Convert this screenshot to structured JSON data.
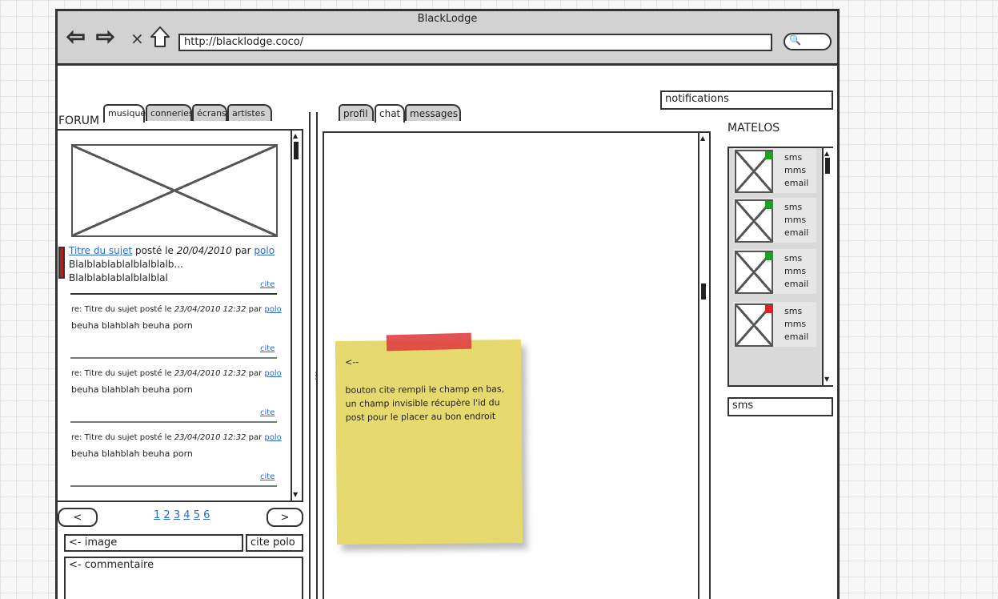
{
  "browser": {
    "title": "BlackLodge",
    "url": "http://blacklodge.coco/"
  },
  "header": {
    "notifications_label": "notifications"
  },
  "forum": {
    "label": "FORUM",
    "tabs": [
      "musique",
      "conneries",
      "écrans",
      "artistes"
    ],
    "active_tab": "musique",
    "topic": {
      "title": "Titre du sujet",
      "posted_on": "posté le",
      "date": "20/04/2010",
      "by": "par",
      "author": "polo",
      "excerpt_line1": "Blalblablablalblalblalb...",
      "excerpt_line2": "Blalblablablalblalblal",
      "cite": "cite"
    },
    "replies": [
      {
        "prefix": "re: Titre du sujet posté le",
        "date": "23/04/2010 12:32",
        "by": "par",
        "author": "polo",
        "body": "beuha blahblah beuha porn",
        "cite": "cite"
      },
      {
        "prefix": "re: Titre du sujet posté le",
        "date": "23/04/2010 12:32",
        "by": "par",
        "author": "polo",
        "body": "beuha blahblah beuha porn",
        "cite": "cite"
      },
      {
        "prefix": "re: Titre du sujet posté le",
        "date": "23/04/2010 12:32",
        "by": "par",
        "author": "polo",
        "body": "beuha blahblah beuha porn",
        "cite": "cite"
      }
    ],
    "pager": {
      "prev": "<",
      "next": ">",
      "pages": [
        "1",
        "2",
        "3",
        "4",
        "5",
        "6"
      ]
    },
    "image_field": "<- image",
    "cite_field": "cite polo",
    "comment_field": "<- commentaire"
  },
  "center": {
    "tabs": [
      "profil",
      "chat",
      "messages"
    ],
    "active_tab": "chat"
  },
  "sticky_note": {
    "arrow": "<--",
    "text": "bouton cite rempli le champ en bas, un champ invisible récupère l'id du post pour le placer au bon endroit"
  },
  "matelos": {
    "title": "MATELOS",
    "contacts": [
      {
        "status_color": "#1aa31a",
        "links": [
          "sms",
          "mms",
          "email"
        ]
      },
      {
        "status_color": "#1aa31a",
        "links": [
          "sms",
          "mms",
          "email"
        ]
      },
      {
        "status_color": "#1aa31a",
        "links": [
          "sms",
          "mms",
          "email"
        ]
      },
      {
        "status_color": "#e02020",
        "links": [
          "sms",
          "mms",
          "email"
        ]
      }
    ],
    "sms_field": "sms"
  }
}
